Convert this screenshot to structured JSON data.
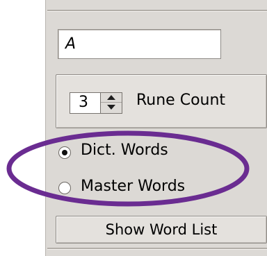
{
  "text_field": {
    "value": "A"
  },
  "rune_count": {
    "value": "3",
    "label": "Rune Count"
  },
  "word_source": {
    "options": [
      {
        "label": "Dict. Words",
        "checked": true
      },
      {
        "label": "Master Words",
        "checked": false
      }
    ]
  },
  "show_word_list": {
    "label": "Show Word List"
  },
  "annotation": {
    "color": "#6a2c91"
  }
}
